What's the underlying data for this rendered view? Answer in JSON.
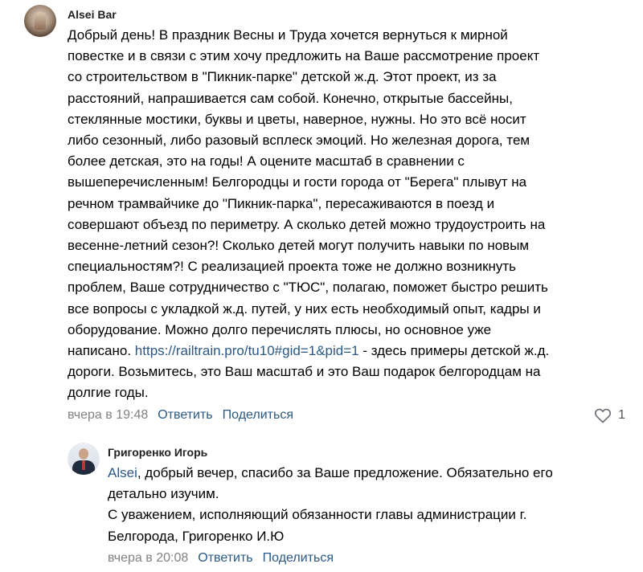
{
  "comment": {
    "author": "Alsei Bar",
    "text_before_link": "Добрый день! В праздник Весны и Труда хочется вернуться к мирной\nповестке и в связи с этим хочу предложить на Ваше рассмотрение проект\nсо строительством в \"Пикник-парке\" детской ж.д. Этот проект, из за\nрасстояний, напрашивается сам собой. Конечно, открытые бассейны,\nстеклянные мостики, буквы и цветы, наверное, нужны. Но это всё носит\nлибо сезонный, либо разовый всплеск эмоций. Но железная дорога, тем\nболее детская, это на годы! А оцените масштаб в сравнении с\nвышеперечисленным! Белгородцы и гости города от \"Берега\" плывут на\nречном трамвайчике до \"Пикник-парка\", пересаживаются в поезд и\nсовершают объезд по периметру. А сколько детей можно трудоустроить на\nвесенне-летний сезон?! Сколько детей могут получить навыки по новым\nспециальностям?! С реализацией проекта тоже не должно возникнуть\nпроблем, Ваше сотрудничество с \"ТЮС\", полагаю, поможет быстро решить\nвсе вопросы с укладкой ж.д. путей, у них есть необходимый опыт, кадры и\nоборудование. Можно долго перечислять плюсы, но основное уже\nнаписано. ",
    "link_text": "https://railtrain.pro/tu10#gid=1&pid=1",
    "text_after_link": " - здесь примеры детской ж.д.\nдороги. Возьмитесь, это Ваш масштаб и это Ваш подарок белгородцам на\nдолгие годы.",
    "time": "вчера в 19:48",
    "reply_label": "Ответить",
    "share_label": "Поделиться",
    "likes_count": "1",
    "heart_icon": "heart-outline-icon"
  },
  "reply": {
    "author": "Григоренко Игорь",
    "mention": "Alsei",
    "text": ", добрый вечер, спасибо за Ваше предложение. Обязательно его\nдетально изучим.\nС уважением, исполняющий обязанности главы администрации г.\nБелгорода, Григоренко И.Ю",
    "time": "вчера в 20:08",
    "reply_label": "Ответить",
    "share_label": "Поделиться"
  },
  "colors": {
    "link": "#2a5885",
    "meta": "#828282",
    "text": "#000000"
  }
}
